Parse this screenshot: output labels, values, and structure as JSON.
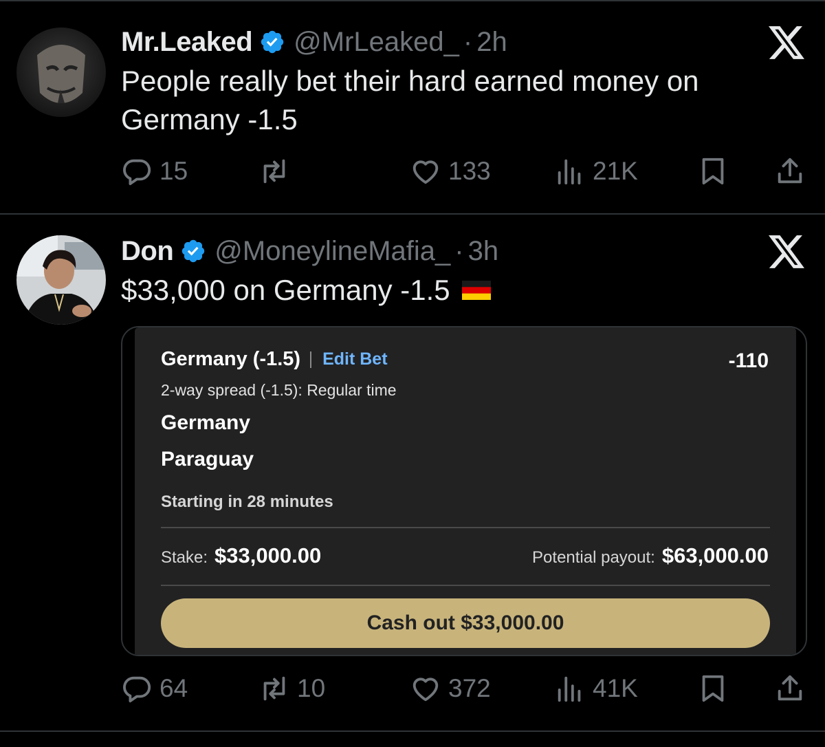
{
  "tweets": [
    {
      "name": "Mr.Leaked",
      "handle": "@MrLeaked_",
      "separator": "·",
      "time": "2h",
      "text": "People really bet their hard earned money on Germany -1.5",
      "replies": "15",
      "retweets": "",
      "likes": "133",
      "views": "21K"
    },
    {
      "name": "Don",
      "handle": "@MoneylineMafia_",
      "separator": "·",
      "time": "3h",
      "text": "$33,000 on Germany -1.5 ",
      "replies": "64",
      "retweets": "10",
      "likes": "372",
      "views": "41K",
      "bet_slip": {
        "title": "Germany (-1.5)",
        "edit_label": "Edit Bet",
        "odds": "-110",
        "market": "2-way spread (-1.5): Regular time",
        "team_home": "Germany",
        "team_away": "Paraguay",
        "status": "Starting in 28 minutes",
        "stake_label": "Stake:",
        "stake_value": "$33,000.00",
        "payout_label": "Potential payout:",
        "payout_value": "$63,000.00",
        "cashout_label": "Cash out $33,000.00"
      }
    }
  ],
  "colors": {
    "background": "#000000",
    "verified": "#1d9bf0",
    "muted": "#71767b",
    "cashout": "#c8b47b",
    "edit_link": "#6fb6ff"
  },
  "icons": [
    "verified-badge-icon",
    "x-logo-icon",
    "reply-icon",
    "retweet-icon",
    "like-icon",
    "views-icon",
    "bookmark-icon",
    "share-icon",
    "germany-flag-icon"
  ]
}
